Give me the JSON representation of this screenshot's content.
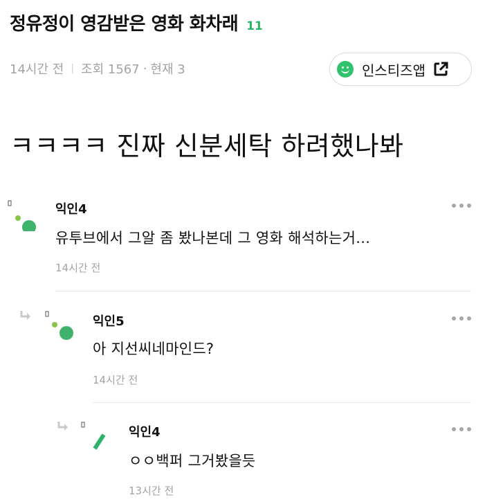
{
  "post": {
    "title": "정유정이 영감받은 영화 화차래",
    "comment_count": "11",
    "time": "14시간 전",
    "views_label": "조회 1567",
    "current_label": "현재 3",
    "body": "ㅋㅋㅋㅋ 진짜 신분세탁 하려했나봐"
  },
  "app_button": {
    "label": "인스티즈앱",
    "icon": "smile-icon",
    "accent": "#31c26d"
  },
  "comments": [
    {
      "nick": "익인4",
      "text": "유투브에서 그알 좀 봤나본데 그 영화 해석하는거...",
      "time": "14시간 전",
      "depth": 0
    },
    {
      "nick": "익인5",
      "text": "아 지선씨네마인드?",
      "time": "14시간 전",
      "depth": 1
    },
    {
      "nick": "익인4",
      "text": "ㅇㅇ백퍼 그거봤을듯",
      "time": "13시간 전",
      "depth": 2
    }
  ],
  "colors": {
    "brand_green": "#2fb36a",
    "meta_gray": "#a3a3a3"
  }
}
